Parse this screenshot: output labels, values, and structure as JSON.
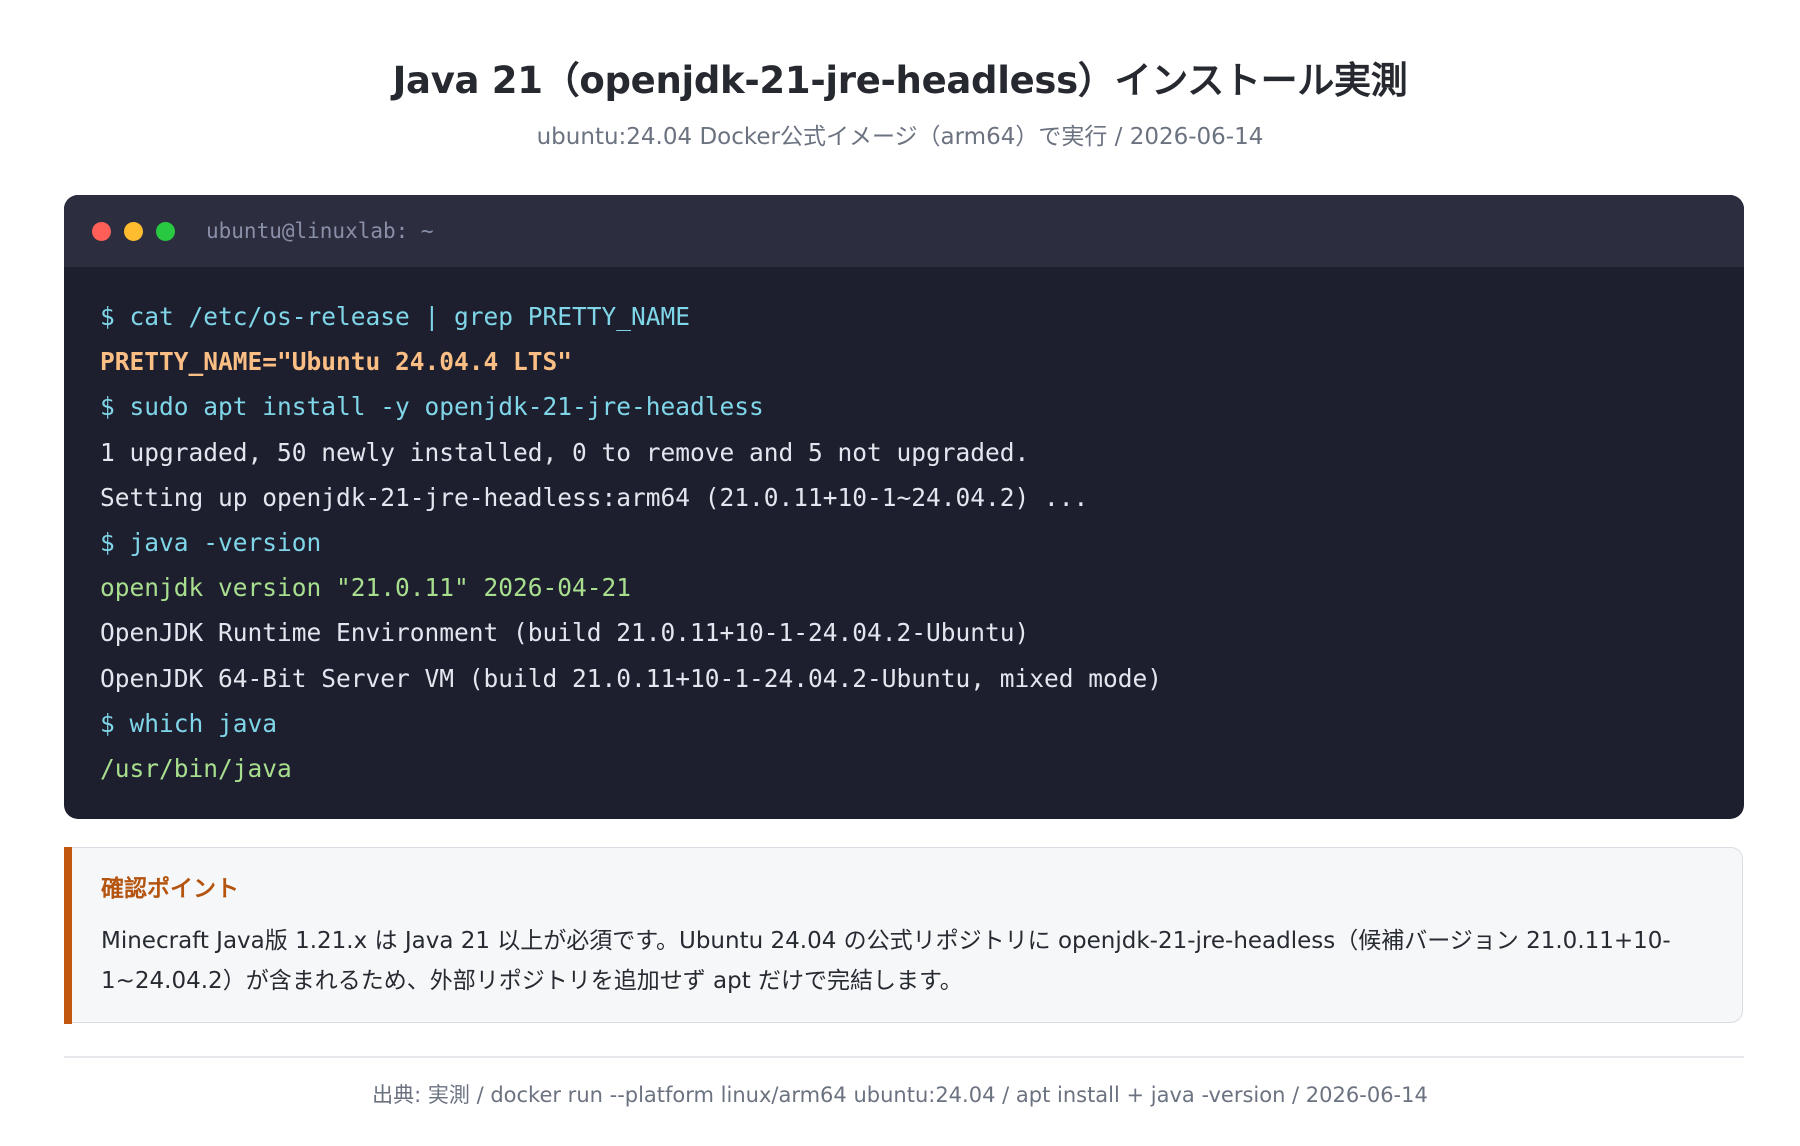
{
  "header": {
    "title": "Java 21（openjdk-21-jre-headless）インストール実測",
    "subtitle": "ubuntu:24.04 Docker公式イメージ（arm64）で実行 / 2026-06-14"
  },
  "terminal": {
    "title": "ubuntu@linuxlab: ~",
    "lines": [
      {
        "text": "$ cat /etc/os-release | grep PRETTY_NAME",
        "kind": "cmd"
      },
      {
        "text": "PRETTY_NAME=\"Ubuntu 24.04.4 LTS\"",
        "kind": "highlight"
      },
      {
        "text": "$ sudo apt install -y openjdk-21-jre-headless",
        "kind": "cmd"
      },
      {
        "text": "1 upgraded, 50 newly installed, 0 to remove and 5 not upgraded.",
        "kind": "plain"
      },
      {
        "text": "Setting up openjdk-21-jre-headless:arm64 (21.0.11+10-1~24.04.2) ...",
        "kind": "plain"
      },
      {
        "text": "$ java -version",
        "kind": "cmd"
      },
      {
        "text": "openjdk version \"21.0.11\" 2026-04-21",
        "kind": "success"
      },
      {
        "text": "OpenJDK Runtime Environment (build 21.0.11+10-1-24.04.2-Ubuntu)",
        "kind": "plain"
      },
      {
        "text": "OpenJDK 64-Bit Server VM (build 21.0.11+10-1-24.04.2-Ubuntu, mixed mode)",
        "kind": "plain"
      },
      {
        "text": "$ which java",
        "kind": "cmd"
      },
      {
        "text": "/usr/bin/java",
        "kind": "success"
      }
    ]
  },
  "callout": {
    "title": "確認ポイント",
    "text": "Minecraft Java版 1.21.x は Java 21 以上が必須です。Ubuntu 24.04 の公式リポジトリに openjdk-21-jre-headless（候補バージョン 21.0.11+10-1~24.04.2）が含まれるため、外部リポジトリを追加せず apt だけで完結します。"
  },
  "footer": {
    "text": "出典: 実測 / docker run --platform linux/arm64 ubuntu:24.04 / apt install + java -version / 2026-06-14"
  },
  "colors": {
    "terminal_bg": "#1e1f2e",
    "terminal_bar": "#2c2e40",
    "command": "#7fd6e8",
    "highlight": "#fbbf85",
    "success": "#a8df8e",
    "accent": "#c2570f"
  }
}
